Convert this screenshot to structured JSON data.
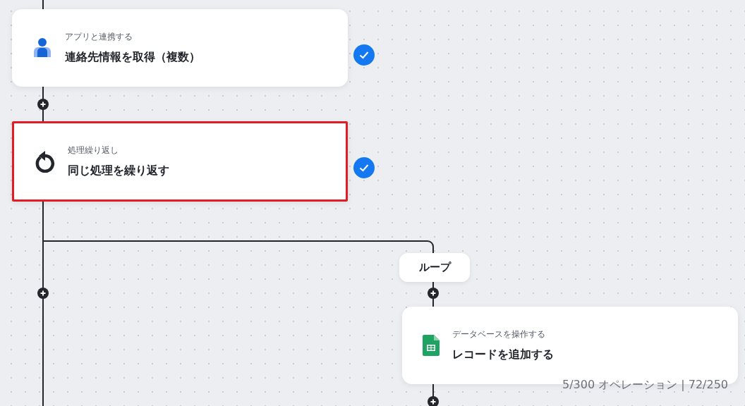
{
  "steps": [
    {
      "kind": "contacts",
      "category": "アプリと連携する",
      "title": "連絡先情報を取得（複数）",
      "done": true,
      "highlighted": false
    },
    {
      "kind": "loop",
      "category": "処理繰り返し",
      "title": "同じ処理を繰り返す",
      "done": true,
      "highlighted": true
    }
  ],
  "branch": {
    "label": "ループ"
  },
  "loop_steps": [
    {
      "kind": "sheet",
      "category": "データベースを操作する",
      "title": "レコードを追加する",
      "done": false,
      "highlighted": false
    }
  ],
  "usage": "5/300 オペレーション | 72/250"
}
